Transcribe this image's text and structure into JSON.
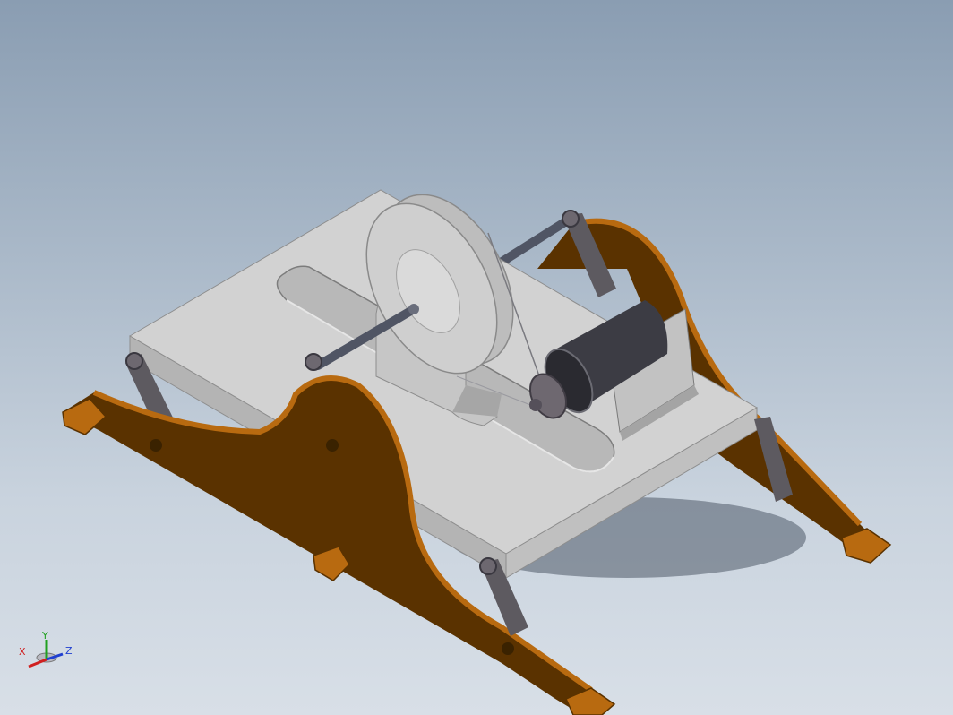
{
  "triad": {
    "x_label": "X",
    "y_label": "Y",
    "z_label": "Z",
    "x_color": "#d02020",
    "y_color": "#20a020",
    "z_color": "#2040d0"
  },
  "colors": {
    "frame_wood": "#5a3200",
    "frame_wood_light": "#b86a10",
    "plate_top": "#d2d2d2",
    "plate_side": "#b4b4b4",
    "shaft": "#505564",
    "motor_body": "#3c3c44"
  }
}
